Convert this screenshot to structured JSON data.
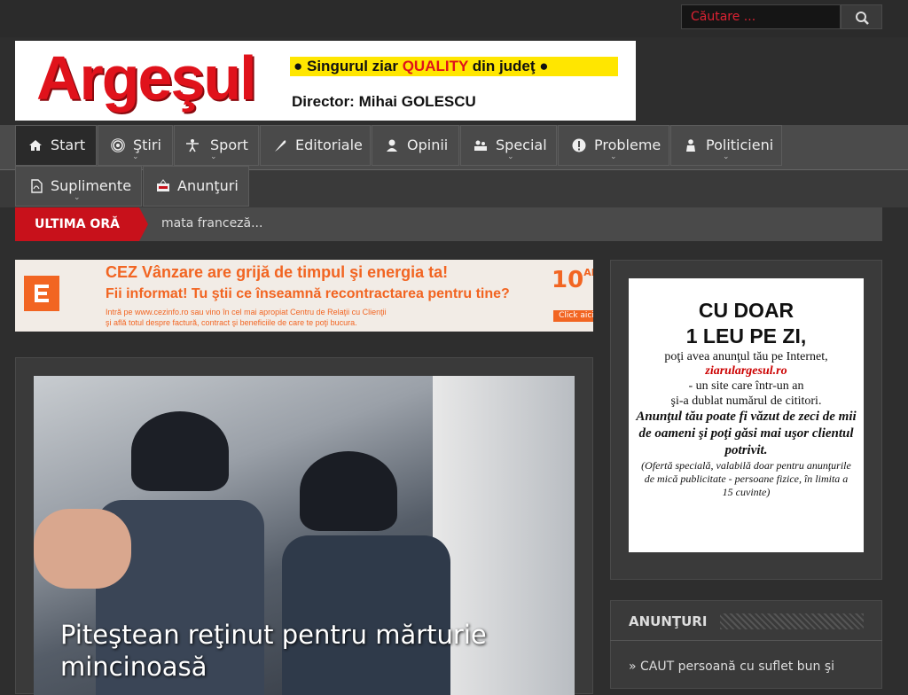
{
  "search": {
    "placeholder": "Căutare ..."
  },
  "banner": {
    "logo": "Argeşul",
    "tagline_pre": "Singurul ziar ",
    "tagline_quality": "QUALITY",
    "tagline_post": " din judeţ",
    "director": "Director: Mihai GOLESCU"
  },
  "nav": {
    "items": [
      {
        "label": "Start",
        "icon": "home-icon",
        "active": true
      },
      {
        "label": "Ştiri",
        "icon": "broadcast-icon"
      },
      {
        "label": "Sport",
        "icon": "person-icon"
      },
      {
        "label": "Editoriale",
        "icon": "feather-icon"
      },
      {
        "label": "Opinii",
        "icon": "user-icon"
      },
      {
        "label": "Special",
        "icon": "group-icon"
      },
      {
        "label": "Probleme",
        "icon": "alert-icon"
      },
      {
        "label": "Politicieni",
        "icon": "politician-icon"
      },
      {
        "label": "Suplimente",
        "icon": "pdf-icon"
      },
      {
        "label": "Anunţuri",
        "icon": "sale-icon"
      }
    ]
  },
  "ticker": {
    "label": "ULTIMA ORĂ",
    "text": "mata franceză..."
  },
  "ad": {
    "line1": "CEZ Vânzare are grijă de timpul şi energia ta!",
    "line2": "Fii informat! Tu ştii ce înseamnă recontractarea pentru tine?",
    "line3a": "Intră pe www.cezinfo.ro sau vino în cel mai apropiat Centru de Relaţii cu Clienţii",
    "line3b": "şi află totul despre factură, contract şi beneficiile de care te poţi bucura.",
    "ten": "10",
    "ani": "ANI",
    "click": "Click aici"
  },
  "story": {
    "headline": "Piteştean reţinut pentru mărturie mincinoasă"
  },
  "side_ad": {
    "l1": "CU DOAR",
    "l2": "1 LEU PE ZI,",
    "l3": "poţi avea anunţul tău pe Internet,",
    "l4": "ziarulargesul.ro",
    "l5": "- un site care într-un an",
    "l6": "şi-a dublat numărul de cititori.",
    "l7": "Anunţul tău poate fi văzut de zeci de mii de oameni şi poţi găsi mai uşor clientul potrivit.",
    "l8": "(Ofertă specială, valabilă doar pentru anunţurile de mică publicitate - persoane fizice, în limita a 15 cuvinte)"
  },
  "anunturi": {
    "title": "ANUNŢURI",
    "item1": "CAUT persoană cu suflet bun şi"
  }
}
